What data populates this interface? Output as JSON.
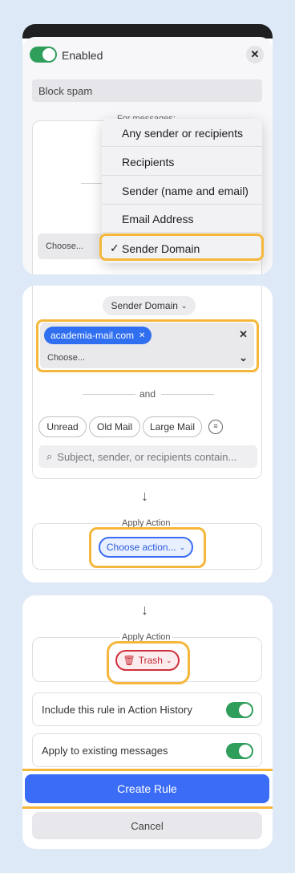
{
  "header": {
    "enabled_label": "Enabled",
    "close_icon": "close-icon"
  },
  "rule_name": "Block spam",
  "conditions": {
    "for_messages_label": "For messages:",
    "dropdown_items": [
      "Any sender or recipients",
      "Recipients",
      "Sender (name and email)",
      "Email Address",
      "Sender Domain"
    ],
    "selected_item": "Sender Domain",
    "choose_placeholder": "Choose...",
    "field_selector": "Sender Domain",
    "chips": [
      "academia-mail.com"
    ],
    "and_label": "and",
    "filters": [
      "Unread",
      "Old Mail",
      "Large Mail"
    ],
    "search_placeholder": "Subject, sender, or recipients contain..."
  },
  "action1": {
    "label": "Apply Action",
    "button": "Choose action..."
  },
  "action2": {
    "label": "Apply Action",
    "button": "Trash"
  },
  "options": {
    "include_history": "Include this rule in Action History",
    "apply_existing": "Apply to existing messages"
  },
  "buttons": {
    "create": "Create Rule",
    "cancel": "Cancel"
  },
  "colors": {
    "accent": "#3b6cf6",
    "toggle_on": "#2f9e5b",
    "highlight": "#f5b73b",
    "trash": "#d0303a"
  }
}
